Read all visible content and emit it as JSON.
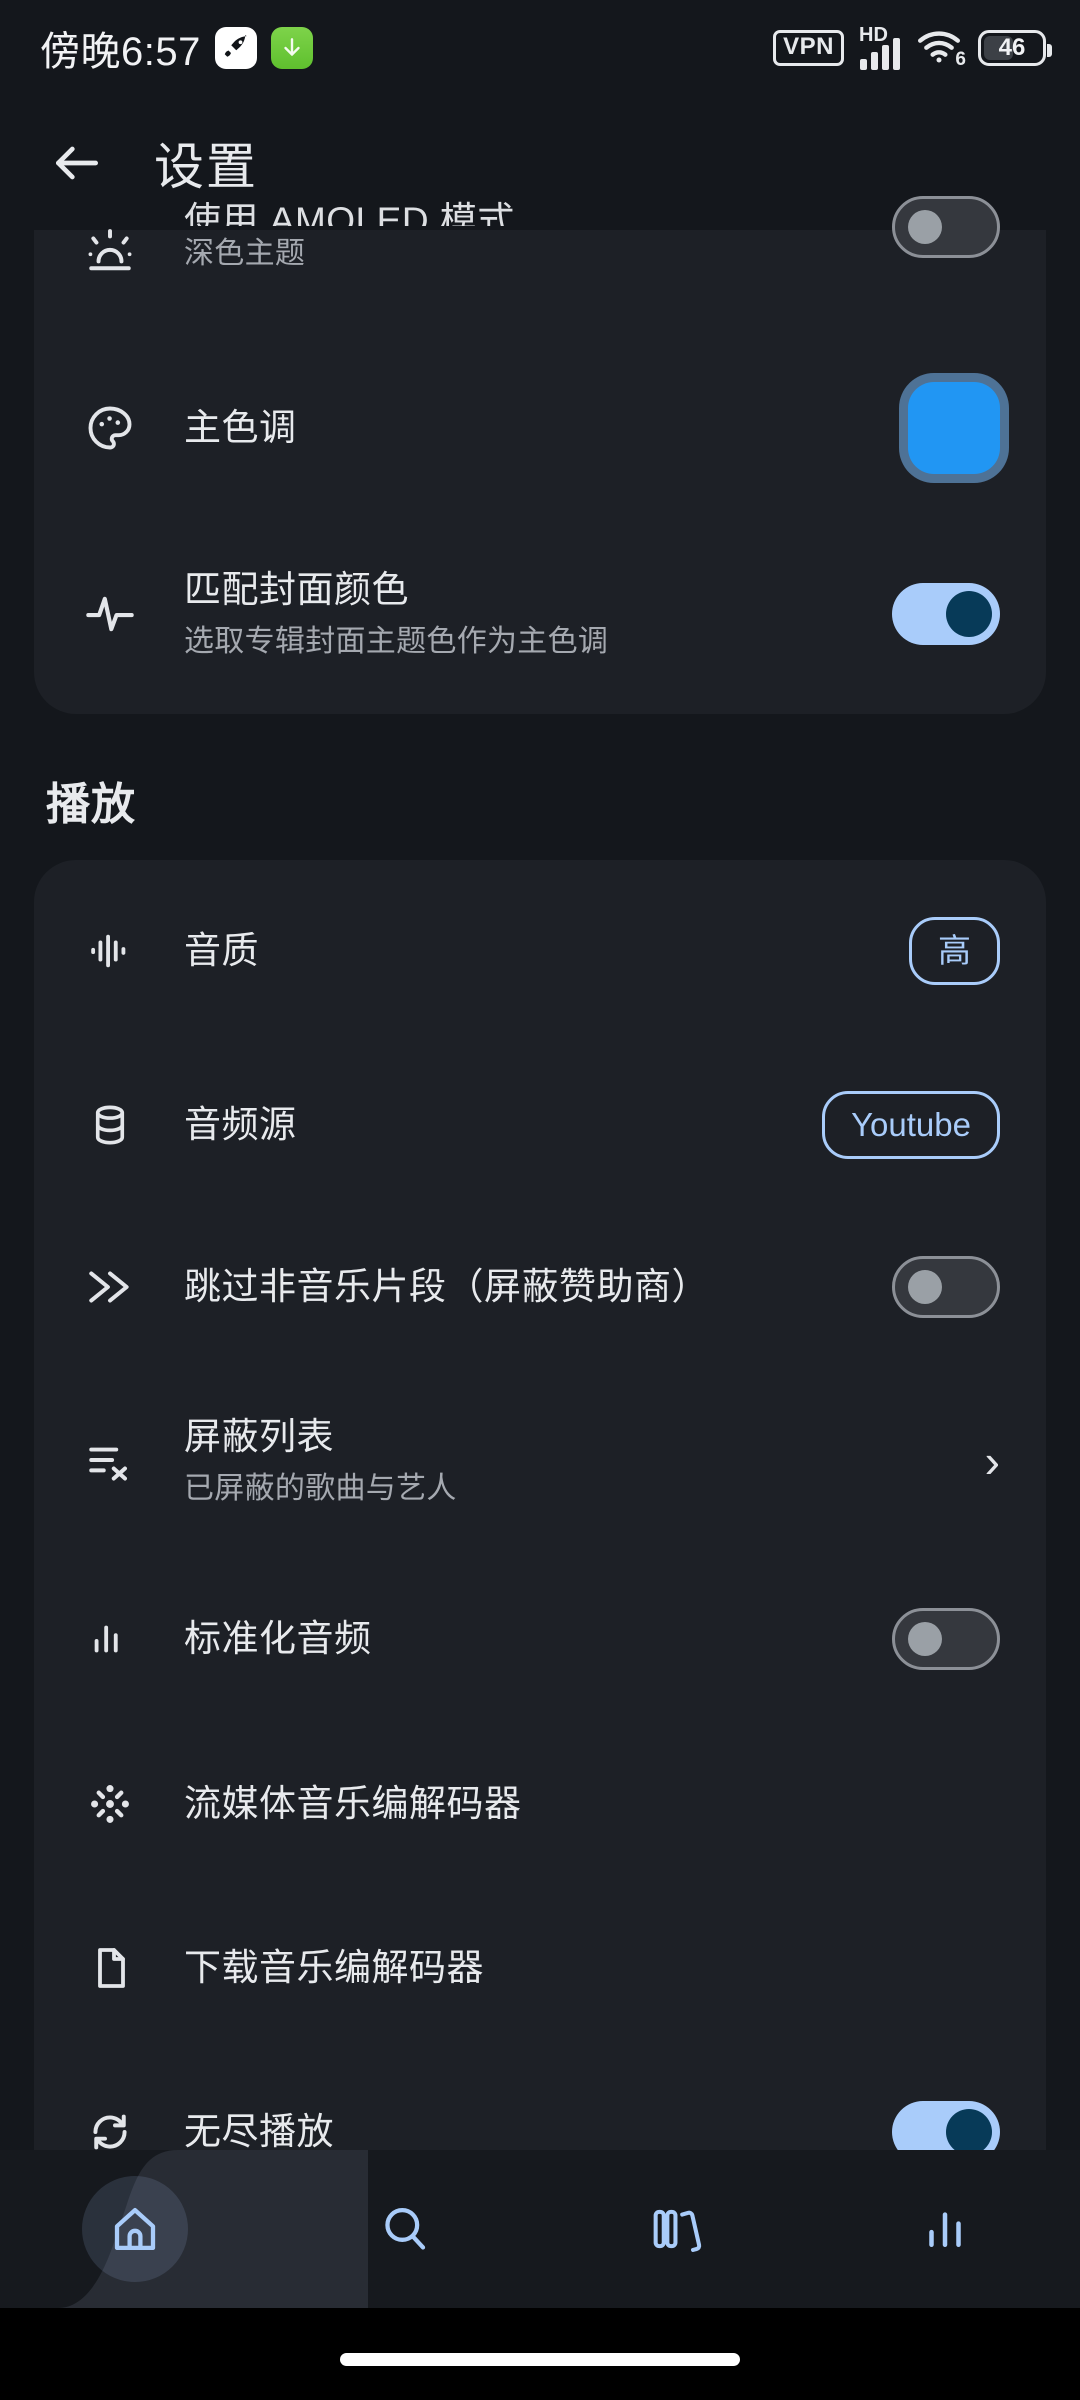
{
  "statusbar": {
    "clock": "傍晚6:57",
    "icons": {
      "rocket": "rocket-app-icon",
      "download": "download-app-icon",
      "vpn_label": "VPN",
      "hd_label": "HD",
      "wifi_generation": "6",
      "battery_level": "46"
    }
  },
  "header": {
    "back": "back-arrow",
    "title": "设置"
  },
  "appearance_card": {
    "rows": [
      {
        "icon": "sunrise-icon",
        "title": "使用 AMOLED 模式",
        "sub": "深色主题",
        "control": "toggle",
        "value": "off"
      },
      {
        "icon": "palette-icon",
        "title": "主色调",
        "sub": "",
        "control": "color-swatch",
        "value": "#2196F3"
      },
      {
        "icon": "pulse-icon",
        "title": "匹配封面颜色",
        "sub": "选取专辑封面主题色作为主色调",
        "control": "toggle",
        "value": "on"
      }
    ]
  },
  "playback": {
    "section_title": "播放",
    "rows": [
      {
        "icon": "waveform-icon",
        "title": "音质",
        "sub": "",
        "control": "chip",
        "value": "高"
      },
      {
        "icon": "database-icon",
        "title": "音频源",
        "sub": "",
        "control": "chip",
        "value": "Youtube"
      },
      {
        "icon": "fast-forward-icon",
        "title": "跳过非音乐片段（屏蔽赞助商）",
        "sub": "",
        "control": "toggle",
        "value": "off"
      },
      {
        "icon": "playlist-remove-icon",
        "title": "屏蔽列表",
        "sub": "已屏蔽的歌曲与艺人",
        "control": "chevron",
        "value": "›"
      },
      {
        "icon": "bar-chart-icon",
        "title": "标准化音频",
        "sub": "",
        "control": "toggle",
        "value": "off"
      },
      {
        "icon": "broadcast-icon",
        "title": "流媒体音乐编解码器",
        "sub": "",
        "control": "none",
        "value": ""
      },
      {
        "icon": "file-icon",
        "title": "下载音乐编解码器",
        "sub": "",
        "control": "none",
        "value": ""
      },
      {
        "icon": "repeat-icon",
        "title": "无尽播放",
        "sub": "",
        "control": "toggle",
        "value": "on"
      }
    ]
  },
  "bottom_nav": {
    "items": [
      {
        "icon": "home-icon",
        "selected": true
      },
      {
        "icon": "search-icon",
        "selected": false
      },
      {
        "icon": "library-icon",
        "selected": false
      },
      {
        "icon": "stats-icon",
        "selected": false
      }
    ]
  },
  "colors": {
    "background": "#14171C",
    "card": "#1D2026",
    "accent": "#2196F3",
    "toggle_on_track": "#A9CCFA",
    "toggle_on_thumb": "#073A58",
    "toggle_off_track": "#35383E",
    "chip_outline": "#A9CCFA",
    "nav_icon": "#A9CCFA",
    "text_primary": "#E8EAED",
    "text_secondary": "#A5A9B0"
  }
}
